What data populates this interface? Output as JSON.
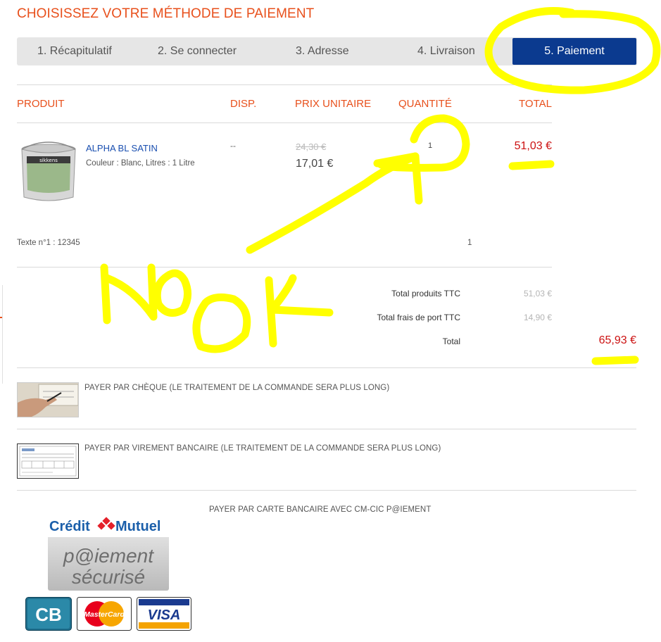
{
  "page": {
    "title": "CHOISISSEZ VOTRE MÉTHODE DE PAIEMENT"
  },
  "steps": [
    {
      "label": "1. Récapitulatif",
      "active": false
    },
    {
      "label": "2. Se connecter",
      "active": false
    },
    {
      "label": "3. Adresse",
      "active": false
    },
    {
      "label": "4. Livraison",
      "active": false
    },
    {
      "label": "5. Paiement",
      "active": true
    }
  ],
  "cart": {
    "headers": {
      "product": "PRODUIT",
      "disp": "DISP.",
      "unit_price": "PRIX UNITAIRE",
      "quantity": "QUANTITÉ",
      "total": "TOTAL"
    },
    "item": {
      "name": "ALPHA BL SATIN",
      "options": "Couleur : Blanc, Litres : 1 Litre",
      "availability": "--",
      "old_price": "24,30 €",
      "price": "17,01 €",
      "quantity": "1",
      "total": "51,03 €",
      "image_brand_text": "sikkens"
    },
    "custom_text": {
      "label": "Texte n°1 : 12345",
      "quantity": "1"
    }
  },
  "totals": {
    "products_label": "Total produits TTC",
    "products_value": "51,03 €",
    "shipping_label": "Total frais de port TTC",
    "shipping_value": "14,90 €",
    "total_label": "Total",
    "total_value": "65,93 €"
  },
  "payment": {
    "cheque": {
      "label": "PAYER PAR CHÈQUE (LE TRAITEMENT DE LA COMMANDE SERA PLUS LONG)",
      "icon": "cheque-photo"
    },
    "transfer": {
      "label": "PAYER PAR VIREMENT BANCAIRE (LE TRAITEMENT DE LA COMMANDE SERA PLUS LONG)",
      "icon": "bank-document"
    },
    "card": {
      "label": "PAYER PAR CARTE BANCAIRE AVEC CM-CIC P@IEMENT",
      "bank_logo": {
        "line1": "Crédit",
        "line2": "Mutuel",
        "line3": "p@iement",
        "line4": "sécurisé"
      },
      "cards": [
        "CB",
        "MasterCard",
        "VISA"
      ]
    }
  },
  "annotations": {
    "text1": "NO",
    "text2": "OK",
    "color": "#ffff00"
  },
  "colors": {
    "accent": "#e8501c",
    "active_step": "#0b3a8f",
    "price_red": "#cc1111",
    "link_blue": "#1a4fb0"
  }
}
